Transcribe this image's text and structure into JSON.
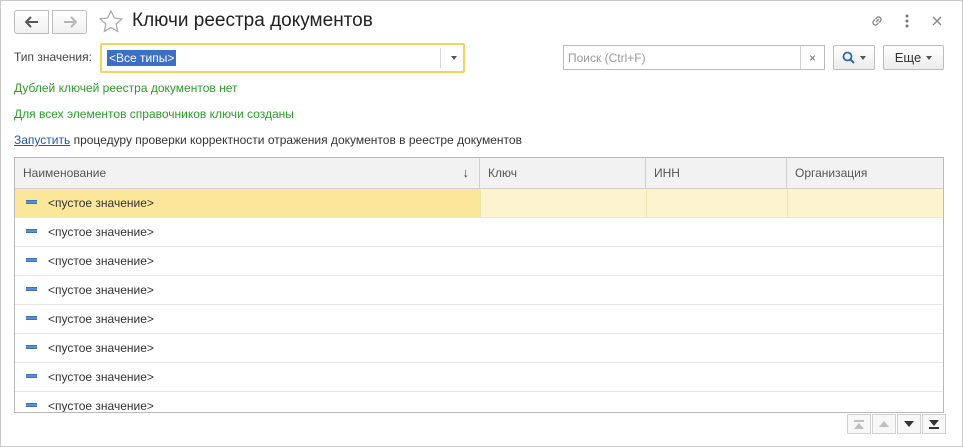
{
  "header": {
    "title": "Ключи реестра документов",
    "back_icon": "arrow-left-icon",
    "forward_icon": "arrow-right-icon",
    "favorite_icon": "star-icon",
    "link_icon": "link-icon",
    "menu_icon": "more-vertical-icon",
    "close_icon": "close-icon"
  },
  "filter": {
    "type_label": "Тип значения:",
    "type_value": "<Все типы>",
    "search_placeholder": "Поиск (Ctrl+F)",
    "clear_label": "×",
    "more_label": "Еще"
  },
  "messages": {
    "no_duplicates": "Дублей ключей реестра документов нет",
    "keys_created": "Для всех элементов справочников ключи созданы",
    "run_link": "Запустить",
    "run_text": " процедуру проверки корректности отражения документов в реестре документов"
  },
  "table": {
    "columns": [
      "Наименование",
      "Ключ",
      "ИНН",
      "Организация"
    ],
    "sort_indicator": "↓",
    "rows": [
      {
        "name": "<пустое значение>",
        "key": "",
        "inn": "",
        "org": "",
        "selected": true
      },
      {
        "name": "<пустое значение>",
        "key": "",
        "inn": "",
        "org": ""
      },
      {
        "name": "<пустое значение>",
        "key": "",
        "inn": "",
        "org": ""
      },
      {
        "name": "<пустое значение>",
        "key": "",
        "inn": "",
        "org": ""
      },
      {
        "name": "<пустое значение>",
        "key": "",
        "inn": "",
        "org": ""
      },
      {
        "name": "<пустое значение>",
        "key": "",
        "inn": "",
        "org": ""
      },
      {
        "name": "<пустое значение>",
        "key": "",
        "inn": "",
        "org": ""
      },
      {
        "name": "<пустое значение>",
        "key": "",
        "inn": "",
        "org": ""
      }
    ]
  },
  "colors": {
    "accent_green": "#2e9a2e",
    "link_blue": "#1f56a8",
    "selection": "#fbe69a",
    "focus_border": "#f0d55a"
  }
}
